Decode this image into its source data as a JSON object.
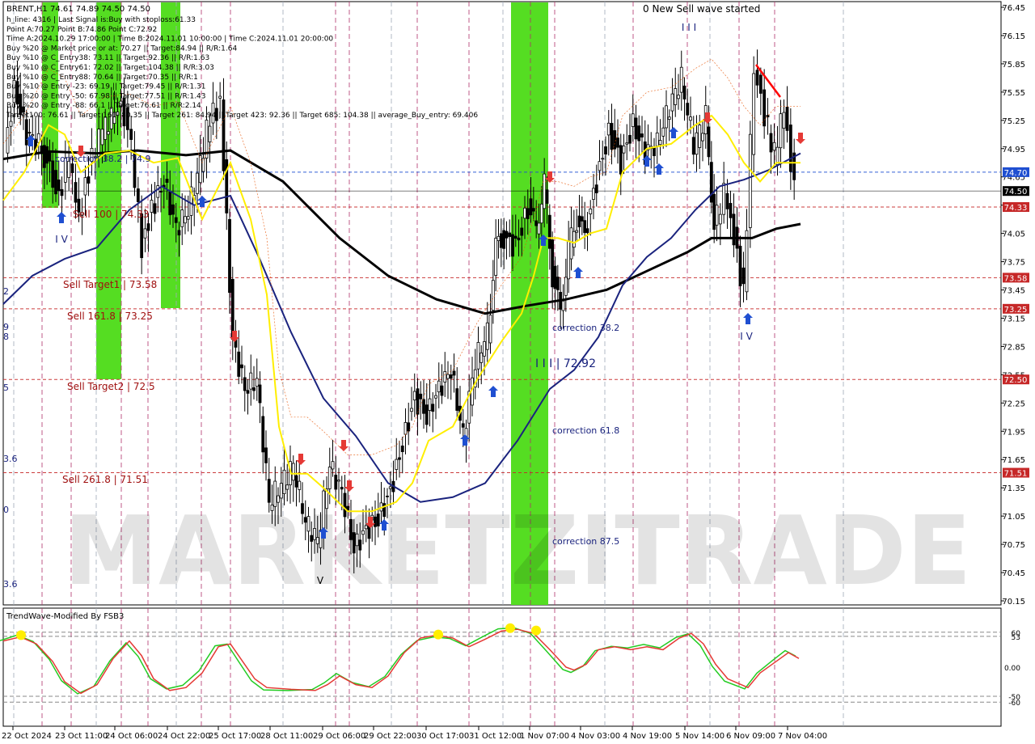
{
  "header": {
    "ohlc_line": "BRENT,H1  74.61 74.89 74.50 74.50",
    "info_lines": [
      "h_line: 4316  |  Last Signal is:Buy with stoploss:61.33",
      "Point A:70.27  Point B:74.86  Point C:72.92",
      "Time A:2024.10.29 17:00:00 | Time B:2024.11.01 10:00:00 | Time C:2024.11.01 20:00:00",
      "Buy %20 @ Market price or at: 70.27 || Target:84.94 || R/R:1.64",
      "Buy %10 @ C_Entry38: 73.11 || Target:92.36 || R/R:1.63",
      "Buy %10 @ C_Entry61: 72.02 || Target:104.38 || R/R:3.03",
      "Buy %10 @ C_Entry88: 70.64 || Target:70.35 || R/R:1",
      "Buy %10 @ Entry -23: 69.19 || Target:79.45 || R/R:1.31",
      "Buy %20 @ Entry -50: 67.98 || Target:77.51 || R/R:1.43",
      "Buy %20 @ Entry -88: 66.1 || Target:76.61 || R/R:2.14",
      "Target100: 76.61 || Target 161: 80.35 || Target 261: 84.94 || Target 423: 92.36 || Target 685: 104.38 || average_Buy_entry: 69.406"
    ]
  },
  "annotations": {
    "sell_wave": "0 New Sell wave started",
    "wave_iii_top": "I I I",
    "wave_iv_left": "I V",
    "wave_iv_right": "I V",
    "wave_v": "V",
    "iii_value": "I I I | 72.92",
    "correction_38": "correction 38.2",
    "correction_61": "correction 61.8",
    "correction_87": "correction 87.5",
    "sell_100": "Sell 100 | 74.33",
    "sell_target1": "Sell Target1 | 73.58",
    "sell_161": "Sell 161.8 | 73.25",
    "sell_target2": "Sell Target2 | 72.5",
    "sell_261": "Sell  261.8 | 71.51",
    "corr_382_left": "correction 38.2 | 74.9",
    "left_partial": [
      "2",
      "9",
      "8",
      "5",
      "3.6",
      "0",
      "3.6"
    ]
  },
  "watermark": "MARKETZITRADE",
  "price_axis": {
    "ticks": [
      "76.45",
      "76.15",
      "75.85",
      "75.55",
      "75.25",
      "74.95",
      "74.65",
      "74.35",
      "74.05",
      "73.75",
      "73.45",
      "73.15",
      "72.85",
      "72.55",
      "72.25",
      "71.95",
      "71.65",
      "71.35",
      "71.05",
      "70.75",
      "70.45",
      "70.15"
    ],
    "badges": [
      {
        "label": "74.70",
        "value": 74.7,
        "color": "#1f4fd1"
      },
      {
        "label": "74.50",
        "value": 74.5,
        "color": "#000000"
      },
      {
        "label": "74.33",
        "value": 74.33,
        "color": "#c62828"
      },
      {
        "label": "73.58",
        "value": 73.58,
        "color": "#c62828"
      },
      {
        "label": "73.25",
        "value": 73.25,
        "color": "#c62828"
      },
      {
        "label": "72.50",
        "value": 72.5,
        "color": "#c62828"
      },
      {
        "label": "71.51",
        "value": 71.51,
        "color": "#c62828"
      }
    ]
  },
  "time_axis": [
    "22 Oct 2024",
    "23 Oct 11:00",
    "24 Oct 06:00",
    "24 Oct 22:00",
    "25 Oct 17:00",
    "28 Oct 11:00",
    "29 Oct 06:00",
    "29 Oct 22:00",
    "30 Oct 17:00",
    "31 Oct 12:00",
    "1 Nov 07:00",
    "4 Nov 03:00",
    "4 Nov 19:00",
    "5 Nov 14:00",
    "6 Nov 09:00",
    "7 Nov 04:00"
  ],
  "oscillator": {
    "title": "TrendWave-Modified By FSB3",
    "ticks": [
      "60",
      "53",
      "0.00",
      "-50",
      "-60"
    ]
  },
  "colors": {
    "green_zone": "#55dd22",
    "ma_black": "#000000",
    "ma_navy": "#1a237e",
    "ma_yellow": "#ffee00",
    "sell_line": "#c62828",
    "buy_arrow": "#1f4fd1",
    "sell_arrow": "#e53935"
  },
  "chart_data": {
    "type": "line",
    "title": "BRENT,H1",
    "ylim": [
      70.1,
      76.5
    ],
    "x": [
      "22 Oct 2024",
      "23 Oct 11:00",
      "24 Oct 06:00",
      "24 Oct 22:00",
      "25 Oct 17:00",
      "28 Oct 11:00",
      "29 Oct 06:00",
      "29 Oct 22:00",
      "30 Oct 17:00",
      "31 Oct 12:00",
      "1 Nov 07:00",
      "4 Nov 03:00",
      "4 Nov 19:00",
      "5 Nov 14:00",
      "6 Nov 09:00",
      "7 Nov 04:00"
    ],
    "series": [
      {
        "name": "price",
        "values": [
          75.0,
          74.6,
          74.5,
          74.1,
          75.2,
          71.1,
          70.7,
          70.9,
          72.2,
          73.9,
          74.0,
          74.3,
          75.0,
          75.7,
          74.3,
          74.5
        ]
      }
    ],
    "horizontal_levels": [
      74.7,
      74.5,
      74.33,
      73.58,
      73.25,
      72.5,
      71.51
    ]
  }
}
